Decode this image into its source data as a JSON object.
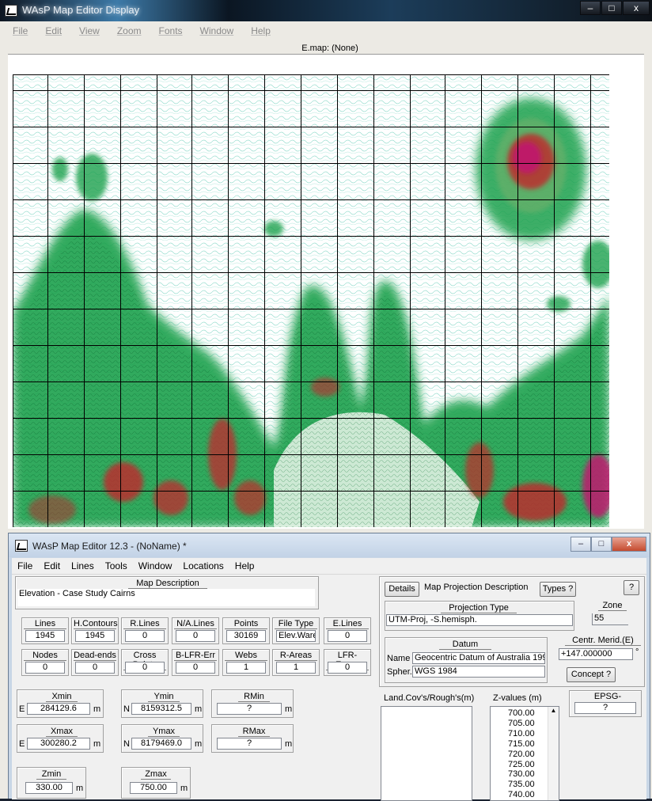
{
  "back_window": {
    "title": "WAsP Map Editor Display",
    "menu": [
      "File",
      "Edit",
      "View",
      "Zoom",
      "Fonts",
      "Window",
      "Help"
    ],
    "caption": "E.map: (None)",
    "controls": {
      "minimize": "–",
      "maximize": "□",
      "close": "x"
    }
  },
  "front_window": {
    "title": "WAsP Map Editor 12.3 - (NoName) *",
    "controls": {
      "minimize": "–",
      "maximize": "□",
      "close": "x"
    },
    "menu": [
      "File",
      "Edit",
      "Lines",
      "Tools",
      "Window",
      "Locations",
      "Help"
    ],
    "map_description": {
      "caption": "Map Description",
      "value": "Elevation - Case Study Cairns"
    },
    "stats_row1": [
      {
        "label": "Lines",
        "value": "1945"
      },
      {
        "label": "H.Contours",
        "value": "1945"
      },
      {
        "label": "R.Lines",
        "value": "0"
      },
      {
        "label": "N/A.Lines",
        "value": "0"
      },
      {
        "label": "Points",
        "value": "30169"
      },
      {
        "label": "File Type",
        "value": "Elev.Warei"
      },
      {
        "label": "E.Lines",
        "value": "0"
      }
    ],
    "stats_row2": [
      {
        "label": "Nodes",
        "value": "0"
      },
      {
        "label": "Dead-ends",
        "value": "0"
      },
      {
        "label": "Cross Points",
        "value": "0"
      },
      {
        "label": "B-LFR-Err",
        "value": "0"
      },
      {
        "label": "Webs",
        "value": "1"
      },
      {
        "label": "R-Areas",
        "value": "1"
      },
      {
        "label": "LFR-Errors",
        "value": "0"
      }
    ],
    "extents": {
      "xmin": {
        "label": "Xmin",
        "prefix": "E",
        "value": "284129.6",
        "unit": "m"
      },
      "ymin": {
        "label": "Ymin",
        "prefix": "N",
        "value": "8159312.5",
        "unit": "m"
      },
      "rmin": {
        "label": "RMin",
        "value": "?",
        "unit": "m"
      },
      "xmax": {
        "label": "Xmax",
        "prefix": "E",
        "value": "300280.2",
        "unit": "m"
      },
      "ymax": {
        "label": "Ymax",
        "prefix": "N",
        "value": "8179469.0",
        "unit": "m"
      },
      "rmax": {
        "label": "RMax",
        "value": "?",
        "unit": "m"
      },
      "zmin": {
        "label": "Zmin",
        "value": "330.00",
        "unit": "m"
      },
      "zmax": {
        "label": "Zmax",
        "value": "750.00",
        "unit": "m"
      }
    },
    "projection": {
      "details_button": "Details",
      "heading": "Map Projection Description",
      "types_button": "Types ?",
      "help_button": "?",
      "type_caption": "Projection Type",
      "type_value": "UTM-Proj, -S.hemisph.",
      "zone_caption": "Zone",
      "zone_value": "55",
      "datum_caption": "Datum",
      "name_label": "Name",
      "name_value": "Geocentric Datum of Australia 199",
      "spher_label": "Spher.",
      "spher_value": "WGS 1984",
      "central_meridian_caption": "Centr. Merid.(E)",
      "central_meridian_value": "+147.000000",
      "degree_symbol": "°",
      "concept_button": "Concept ?"
    },
    "landcover": {
      "caption": "Land.Cov's/Rough's(m)"
    },
    "zvalues": {
      "caption": "Z-values (m)",
      "values": [
        "700.00",
        "705.00",
        "710.00",
        "715.00",
        "720.00",
        "725.00",
        "730.00",
        "735.00",
        "740.00"
      ]
    },
    "epsg": {
      "caption": "EPSG-Code",
      "value": "?"
    }
  },
  "colors": {
    "contour_low": "#3fbfa6",
    "contour_mid": "#1aa14d",
    "contour_high": "#c2262b",
    "contour_peak": "#c0186e",
    "grid": "#000000",
    "window_frame": "#c8d6e6"
  }
}
